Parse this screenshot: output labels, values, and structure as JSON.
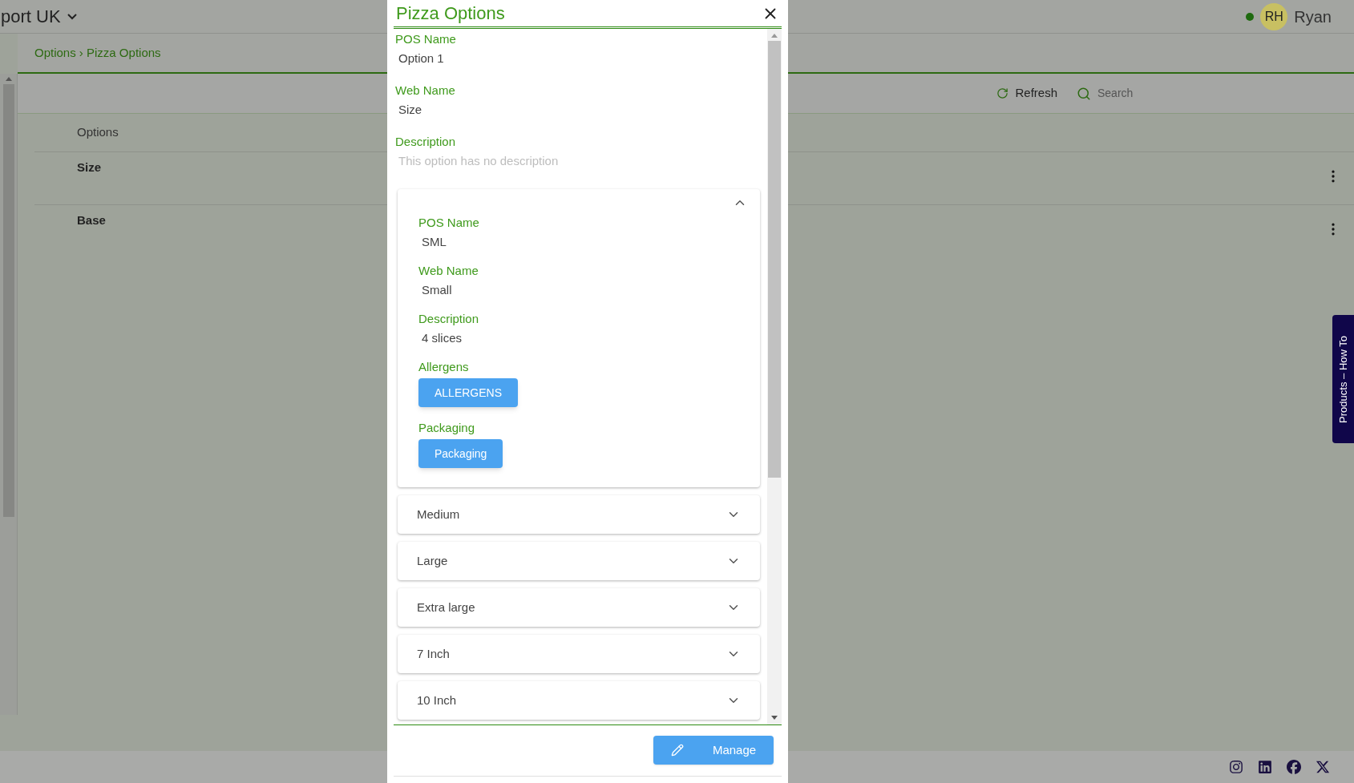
{
  "header": {
    "site": "port UK",
    "user": {
      "initials": "RH",
      "name": "Ryan",
      "online": true
    }
  },
  "breadcrumb": "Options › Pizza Options",
  "toolbar": {
    "refresh": "Refresh",
    "search_placeholder": "Search"
  },
  "table": {
    "column": "Options",
    "rows": [
      "Size",
      "Base"
    ]
  },
  "side_tab": "Products – How To",
  "modal": {
    "title": "Pizza Options",
    "fields": [
      {
        "label": "POS Name",
        "value": "Option 1",
        "muted": false
      },
      {
        "label": "Web Name",
        "value": "Size",
        "muted": false
      },
      {
        "label": "Description",
        "value": "This option has no description",
        "muted": true
      }
    ],
    "options": [
      {
        "expanded": true,
        "fields": [
          {
            "kind": "text",
            "label": "POS Name",
            "value": "SML"
          },
          {
            "kind": "text",
            "label": "Web Name",
            "value": "Small"
          },
          {
            "kind": "text",
            "label": "Description",
            "value": "4 slices"
          },
          {
            "kind": "button",
            "label": "Allergens",
            "value": "ALLERGENS"
          },
          {
            "kind": "button",
            "label": "Packaging",
            "value": "Packaging"
          }
        ]
      },
      {
        "expanded": false,
        "title": "Medium"
      },
      {
        "expanded": false,
        "title": "Large"
      },
      {
        "expanded": false,
        "title": "Extra large"
      },
      {
        "expanded": false,
        "title": "7 Inch"
      },
      {
        "expanded": false,
        "title": "10 Inch"
      }
    ],
    "manage": "Manage"
  }
}
